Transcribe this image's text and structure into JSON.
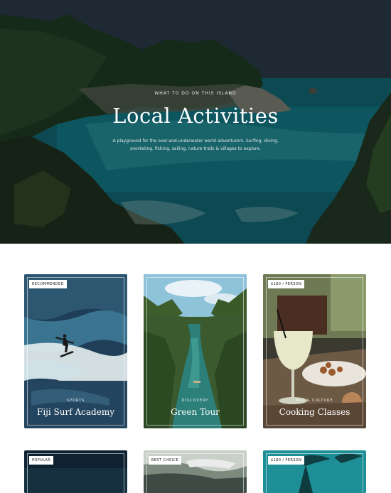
{
  "hero": {
    "eyebrow": "WHAT TO DO ON THIS ISLAND",
    "title": "Local Activities",
    "description": "A playground for the over-and-underwater world adventurers. Surfing, diving, snorkeling, fishing, sailing, nature trails & villages to explore."
  },
  "cards": [
    {
      "badge": "RECOMMENDED",
      "category": "SPORTS",
      "title": "Fiji Surf Academy"
    },
    {
      "badge": "",
      "category": "DISCOVERY",
      "title": "Green Tour"
    },
    {
      "badge": "$180 / PERSON",
      "category": "ART & CULTURE",
      "title": "Cooking Classes"
    },
    {
      "badge": "POPULAR",
      "category": "",
      "title": ""
    },
    {
      "badge": "BEST CHOICE",
      "category": "",
      "title": ""
    },
    {
      "badge": "$180 / PERSON",
      "category": "",
      "title": ""
    }
  ]
}
